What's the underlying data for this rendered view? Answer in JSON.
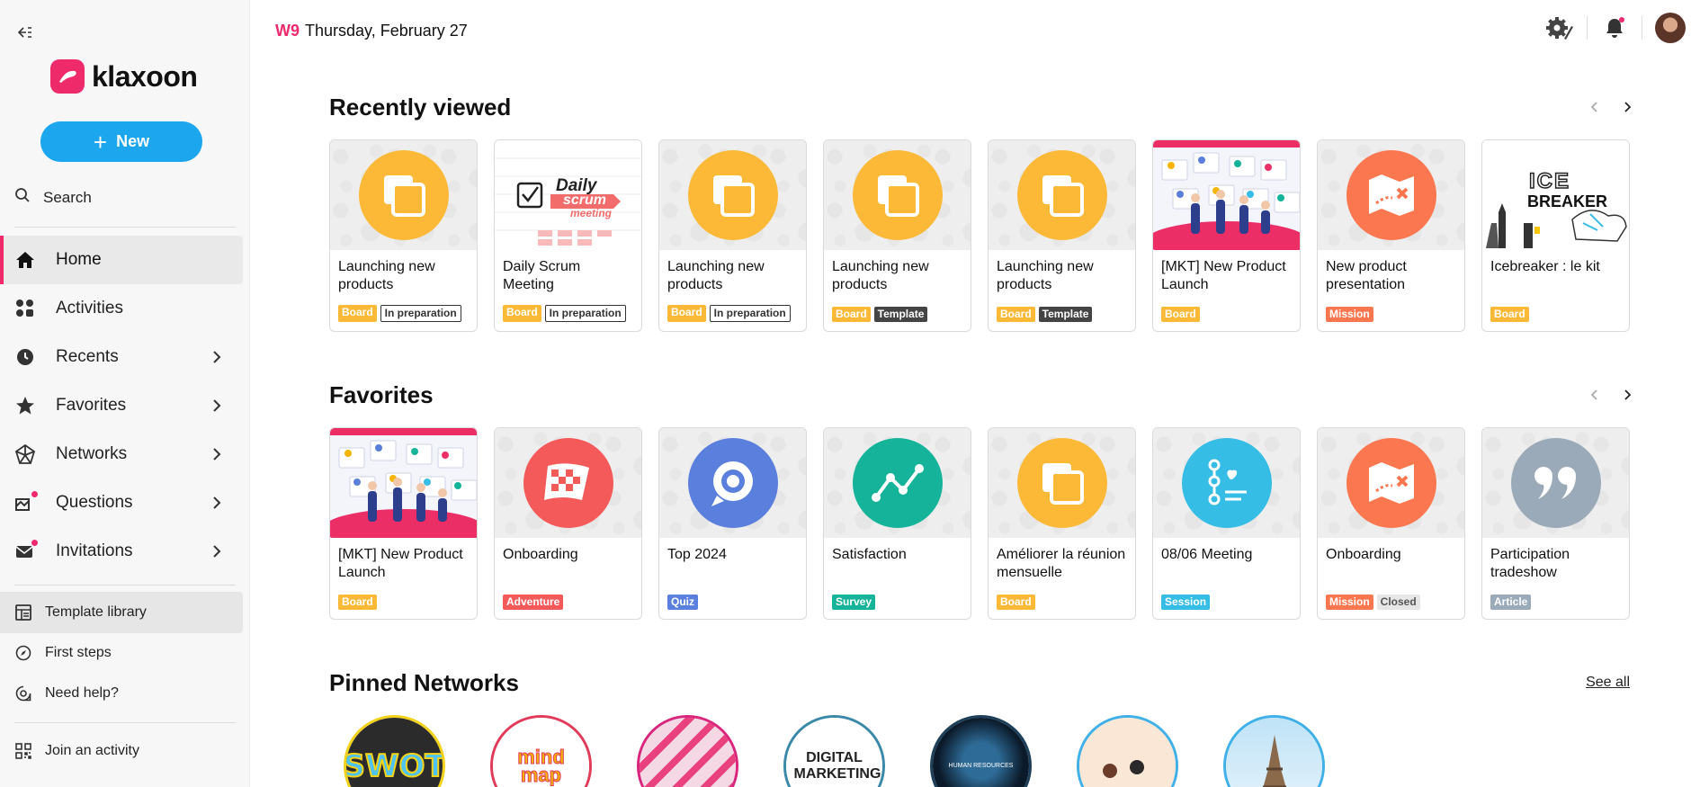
{
  "sidebar": {
    "brand": "klaxoon",
    "new_label": "New",
    "search_label": "Search",
    "nav": [
      {
        "label": "Home",
        "icon": "home-icon"
      },
      {
        "label": "Activities",
        "icon": "activities-icon"
      },
      {
        "label": "Recents",
        "icon": "clock-icon"
      },
      {
        "label": "Favorites",
        "icon": "star-icon"
      },
      {
        "label": "Networks",
        "icon": "network-icon"
      },
      {
        "label": "Questions",
        "icon": "questions-icon"
      },
      {
        "label": "Invitations",
        "icon": "mail-icon"
      }
    ],
    "secondary": [
      {
        "label": "Template library",
        "icon": "template-icon"
      },
      {
        "label": "First steps",
        "icon": "compass-icon"
      },
      {
        "label": "Need help?",
        "icon": "help-icon"
      }
    ],
    "join_label": "Join an activity"
  },
  "header": {
    "week": "W9",
    "date": "Thursday, February 27"
  },
  "recently_viewed": {
    "title": "Recently viewed",
    "cards": [
      {
        "title": "Launching new products",
        "thumb": "board",
        "badges": [
          {
            "text": "Board",
            "style": "board"
          },
          {
            "text": "In preparation",
            "style": "outline"
          }
        ]
      },
      {
        "title": "Daily Scrum Meeting",
        "thumb": "scrum",
        "thumb_text": [
          "Daily",
          "scrum",
          "meeting"
        ],
        "badges": [
          {
            "text": "Board",
            "style": "board"
          },
          {
            "text": "In preparation",
            "style": "outline"
          }
        ]
      },
      {
        "title": "Launching new products",
        "thumb": "board",
        "badges": [
          {
            "text": "Board",
            "style": "board"
          },
          {
            "text": "In preparation",
            "style": "outline"
          }
        ]
      },
      {
        "title": "Launching new products",
        "thumb": "board",
        "badges": [
          {
            "text": "Board",
            "style": "board"
          },
          {
            "text": "Template",
            "style": "dark"
          }
        ]
      },
      {
        "title": "Launching new products",
        "thumb": "board",
        "badges": [
          {
            "text": "Board",
            "style": "board"
          },
          {
            "text": "Template",
            "style": "dark"
          }
        ]
      },
      {
        "title": "[MKT] New Product Launch",
        "thumb": "mkt",
        "badges": [
          {
            "text": "Board",
            "style": "board"
          }
        ]
      },
      {
        "title": "New product presentation",
        "thumb": "mission",
        "badges": [
          {
            "text": "Mission",
            "style": "mission"
          }
        ]
      },
      {
        "title": "Icebreaker : le kit",
        "thumb": "icebreaker",
        "thumb_text": [
          "ICE",
          "BREAKER"
        ],
        "badges": [
          {
            "text": "Board",
            "style": "board"
          }
        ]
      }
    ]
  },
  "favorites": {
    "title": "Favorites",
    "cards": [
      {
        "title": "[MKT] New Product Launch",
        "thumb": "mkt",
        "badges": [
          {
            "text": "Board",
            "style": "board"
          }
        ]
      },
      {
        "title": "Onboarding",
        "thumb": "adventure",
        "badges": [
          {
            "text": "Adventure",
            "style": "adventure"
          }
        ]
      },
      {
        "title": "Top 2024",
        "thumb": "quiz",
        "badges": [
          {
            "text": "Quiz",
            "style": "quiz"
          }
        ]
      },
      {
        "title": "Satisfaction",
        "thumb": "survey",
        "badges": [
          {
            "text": "Survey",
            "style": "survey"
          }
        ]
      },
      {
        "title": "Améliorer la réunion mensuelle",
        "thumb": "board",
        "badges": [
          {
            "text": "Board",
            "style": "board"
          }
        ]
      },
      {
        "title": "08/06 Meeting",
        "thumb": "session",
        "badges": [
          {
            "text": "Session",
            "style": "session"
          }
        ]
      },
      {
        "title": "Onboarding",
        "thumb": "mission",
        "badges": [
          {
            "text": "Mission",
            "style": "mission"
          },
          {
            "text": "Closed",
            "style": "grey"
          }
        ]
      },
      {
        "title": "Participation tradeshow",
        "thumb": "article",
        "badges": [
          {
            "text": "Article",
            "style": "article"
          }
        ]
      }
    ]
  },
  "pinned_networks": {
    "title": "Pinned Networks",
    "see_all": "See all",
    "items": [
      {
        "name": "swot",
        "text": "SWOT",
        "border": "#f2d21a"
      },
      {
        "name": "mind-map",
        "text": "mind map",
        "border": "#e23b5a"
      },
      {
        "name": "pink-network",
        "border": "#d9257d"
      },
      {
        "name": "digital-marketing",
        "text": "DIGITAL MARKETING",
        "border": "#3a89a8"
      },
      {
        "name": "human-resources",
        "text": "HUMAN RESOURCES",
        "border": "#1e3f5a"
      },
      {
        "name": "team-network",
        "border": "#3fb0e8"
      },
      {
        "name": "paris-network",
        "border": "#3fb0e8"
      }
    ]
  },
  "colors": {
    "accent": "#ee2a6b",
    "primary": "#1ba6ee",
    "board": "#fbb937",
    "mission": "#fb774f",
    "adventure": "#f45a5a",
    "quiz": "#5b7fdc",
    "survey": "#15b49a",
    "session": "#35bde6",
    "article": "#9aaab9"
  }
}
